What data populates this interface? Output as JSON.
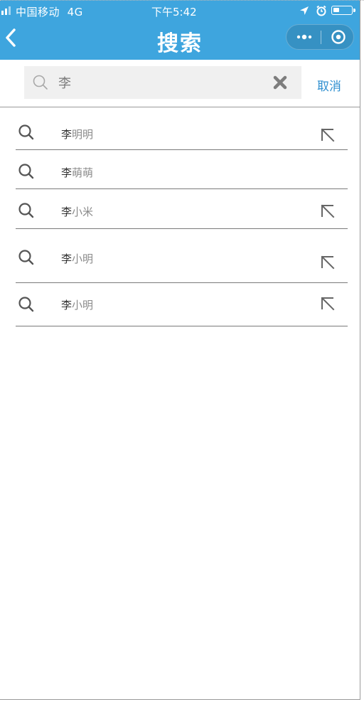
{
  "status_bar": {
    "carrier": "中国移动",
    "network": "4G",
    "time": "下午5:42",
    "battery_level": 0.35
  },
  "nav": {
    "back_icon": "chevron-left-icon",
    "title": "搜索",
    "more_icon": "more-dots-icon",
    "close_icon": "target-circle-icon"
  },
  "search": {
    "query": "李",
    "placeholder": "",
    "search_icon": "search-icon",
    "clear_icon": "clear-x-icon",
    "cancel_label": "取消"
  },
  "results": [
    {
      "match": "李",
      "rest": "明明",
      "show_fill": true
    },
    {
      "match": "李",
      "rest": "萌萌",
      "show_fill": false
    },
    {
      "match": "李",
      "rest": "小米",
      "show_fill": true
    },
    {
      "match": "李",
      "rest": "小明",
      "show_fill": true
    },
    {
      "match": "李",
      "rest": "小明",
      "show_fill": true
    }
  ],
  "colors": {
    "header": "#3ea5de",
    "accent": "#2f8fd0",
    "input_bg": "#f0f0f0",
    "highlight_text": "#333333",
    "secondary_text": "#8a8a8a"
  }
}
